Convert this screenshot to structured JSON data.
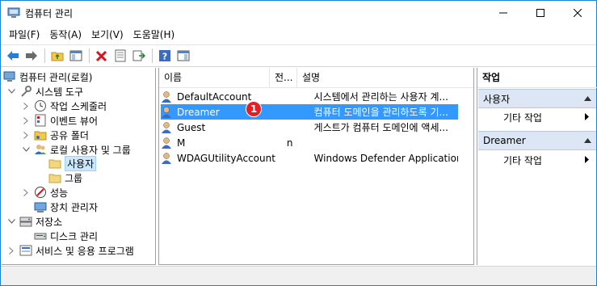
{
  "window": {
    "title": "컴퓨터 관리"
  },
  "menu": [
    "파일(F)",
    "동작(A)",
    "보기(V)",
    "도움말(H)"
  ],
  "tree": {
    "items": [
      {
        "label": "컴퓨터 관리(로컬)",
        "icon": "computer-mgmt-icon"
      },
      {
        "label": "시스템 도구",
        "icon": "tools-icon",
        "expanded": true
      },
      {
        "label": "작업 스케줄러",
        "icon": "clock-icon"
      },
      {
        "label": "이벤트 뷰어",
        "icon": "event-viewer-icon"
      },
      {
        "label": "공유 폴더",
        "icon": "shared-folder-icon"
      },
      {
        "label": "로컬 사용자 및 그룹",
        "icon": "users-groups-icon",
        "expanded": true
      },
      {
        "label": "사용자",
        "icon": "folder-icon",
        "selected": true
      },
      {
        "label": "그룹",
        "icon": "folder-icon"
      },
      {
        "label": "성능",
        "icon": "performance-icon"
      },
      {
        "label": "장치 관리자",
        "icon": "device-manager-icon"
      },
      {
        "label": "저장소",
        "icon": "storage-icon",
        "expanded": true
      },
      {
        "label": "디스크 관리",
        "icon": "disk-icon"
      },
      {
        "label": "서비스 및 응용 프로그램",
        "icon": "services-icon"
      }
    ]
  },
  "list": {
    "columns": [
      "이름",
      "전...",
      "설명"
    ],
    "rows": [
      {
        "name": "DefaultAccount",
        "full": "",
        "desc": "시스템에서 관리하는 사용자 계..."
      },
      {
        "name": "Dreamer",
        "full": "",
        "desc": "컴퓨터 도메인을 관리하도록 기...",
        "selected": true
      },
      {
        "name": "Guest",
        "full": "",
        "desc": "게스트가 컴퓨터 도메인에 액세..."
      },
      {
        "name": "M",
        "full": "n",
        "desc": ""
      },
      {
        "name": "WDAGUtilityAccount",
        "full": "",
        "desc": "Windows Defender Application G..."
      }
    ]
  },
  "badge": "1",
  "actions": {
    "title": "작업",
    "sections": [
      {
        "label": "사용자",
        "items": [
          "기타 작업"
        ]
      },
      {
        "label": "Dreamer",
        "items": [
          "기타 작업"
        ]
      }
    ]
  },
  "colors": {
    "selection": "#3399ff",
    "badge": "#e31e24",
    "action_header": "#dce6f4"
  }
}
